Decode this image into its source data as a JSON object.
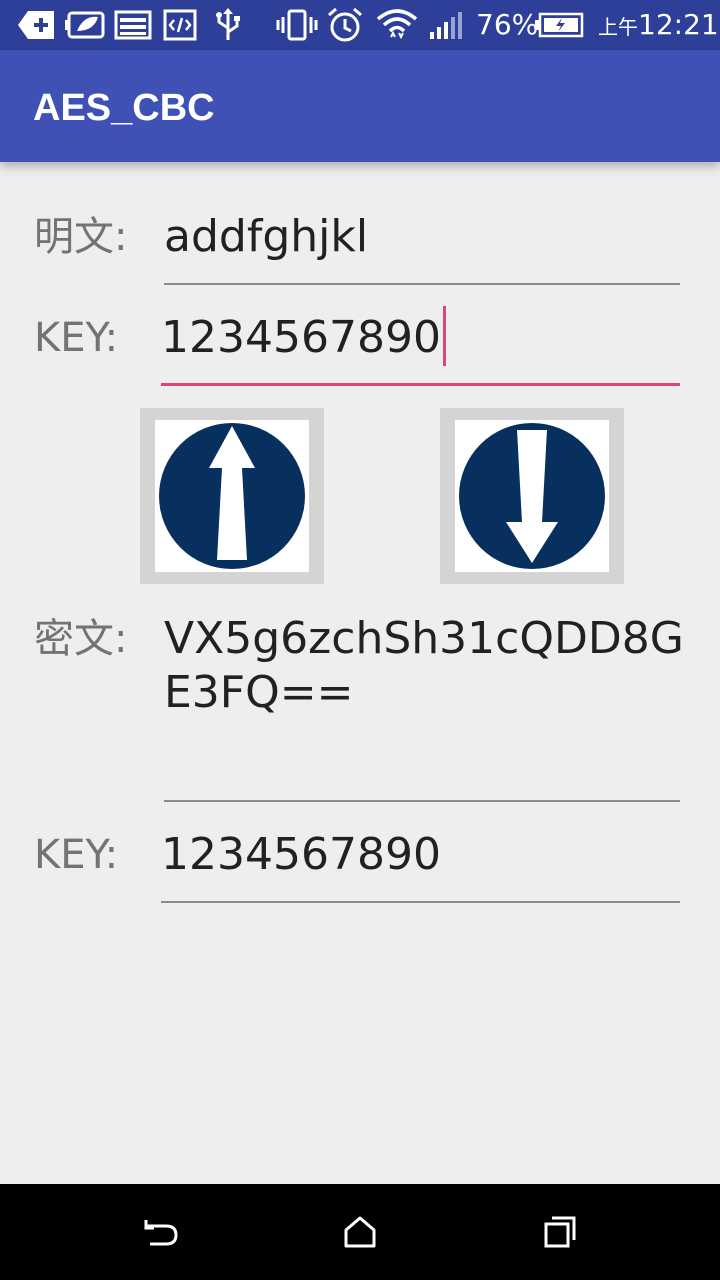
{
  "status_bar": {
    "battery_percent": "76%",
    "time_prefix": "上午",
    "time": "12:21",
    "icons": [
      "add-notification-icon",
      "battery-saver-icon",
      "image-icon",
      "code-icon",
      "usb-icon",
      "vibrate-icon",
      "alarm-icon",
      "wifi-icon",
      "signal-icon",
      "battery-icon"
    ]
  },
  "app_bar": {
    "title": "AES_CBC"
  },
  "form": {
    "plaintext_label": "明文:",
    "plaintext_value": "addfghjkl",
    "key1_label": "KEY:",
    "key1_value": "1234567890",
    "ciphertext_label": "密文:",
    "ciphertext_value": "VX5g6zchSh31cQDD8GE3FQ==",
    "key2_label": "KEY:",
    "key2_value": "1234567890"
  },
  "buttons": {
    "encrypt_icon": "arrow-up-circle-icon",
    "decrypt_icon": "arrow-down-circle-icon",
    "icon_color": "#08305e"
  },
  "colors": {
    "status_bar": "#2d3f99",
    "app_bar": "#3f51b5",
    "accent": "#e0457a",
    "background": "#eeeeee"
  },
  "nav_bar": {
    "icons": [
      "back-icon",
      "home-icon",
      "recents-icon"
    ]
  }
}
